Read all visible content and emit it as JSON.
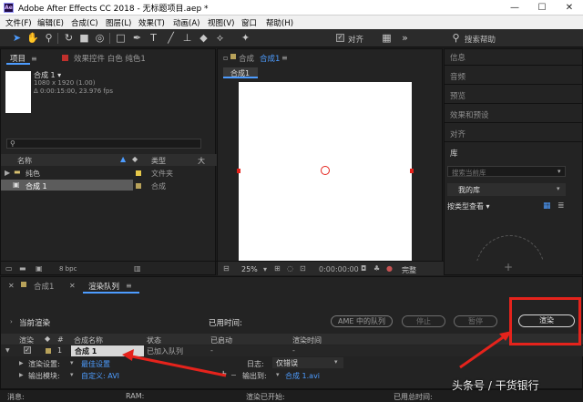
{
  "window": {
    "title": "Adobe After Effects CC 2018 - 无标题项目.aep *",
    "logo": "Ae",
    "min": "—",
    "max": "☐",
    "close": "✕"
  },
  "menu": [
    "文件(F)",
    "编辑(E)",
    "合成(C)",
    "图层(L)",
    "效果(T)",
    "动画(A)",
    "视图(V)",
    "窗口",
    "帮助(H)"
  ],
  "toolbar": {
    "snap_label": "对齐",
    "search_placeholder": "搜索帮助"
  },
  "project": {
    "tab_project": "项目",
    "tab_effects": "效果控件 白色 纯色1",
    "comp_name": "合成 1 ▾",
    "comp_info1": "1080 x 1920 (1.00)",
    "comp_info2": "Δ 0:00:15:00, 23.976 fps",
    "col_name": "名称",
    "col_type": "类型",
    "col_size": "大",
    "items": [
      {
        "name": "纯色",
        "type": "文件夹",
        "color": "#e6c84a"
      },
      {
        "name": "合成 1",
        "type": "合成",
        "color": "#b8a25a"
      }
    ],
    "bpc": "8 bpc"
  },
  "comp": {
    "tab": "合成",
    "tab_name": "合成1",
    "subtab": "合成1",
    "zoom": "25%",
    "timecode": "0:00:00:00",
    "quality": "完整"
  },
  "right_panel": {
    "items": [
      "信息",
      "音频",
      "预览",
      "效果和预设",
      "对齐"
    ],
    "library": "库",
    "lib_search_placeholder": "搜索当前库",
    "my_library": "我的库",
    "view_by_type": "按类型查看 ▾"
  },
  "render": {
    "tab_comp": "合成1",
    "tab_queue": "渲染队列",
    "current_render": "当前渲染",
    "elapsed": "已用时间:",
    "ame_button": "AME 中的队列",
    "stop_button": "停止",
    "pause_button": "暂停",
    "render_button": "渲染",
    "columns": [
      "渲染",
      "#",
      "合成名称",
      "状态",
      "已启动",
      "渲染时间"
    ],
    "row": {
      "num": "1",
      "name": "合成 1",
      "status": "已加入队列",
      "started": "-",
      "time": "-"
    },
    "settings_label": "渲染设置:",
    "settings_value": "最佳设置",
    "output_module_label": "输出模块:",
    "output_module_value": "自定义: AVI",
    "log_label": "日志:",
    "log_value": "仅错误",
    "output_to_label": "输出到:",
    "output_to_value": "合成 1.avi",
    "status_msg": "消息:",
    "status_ram": "RAM:",
    "status_started": "渲染已开始:",
    "status_total": "已用总时间:"
  },
  "watermark": "头条号 / 干货银行",
  "colors": {
    "accent": "#4d9cff",
    "annotation": "#e5231c",
    "panel": "#232323",
    "label_yellow": "#e6c84a"
  }
}
